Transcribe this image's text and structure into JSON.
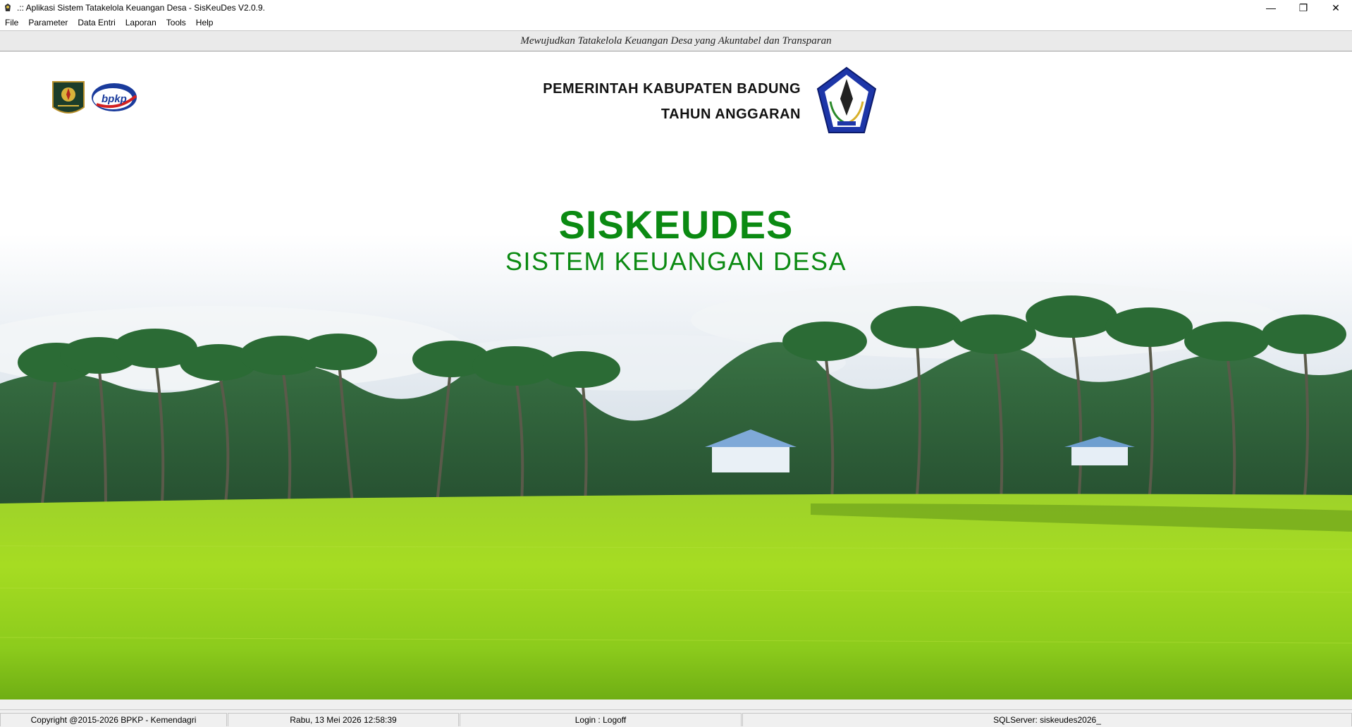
{
  "window": {
    "title": ".:: Aplikasi Sistem Tatakelola Keuangan Desa - SisKeuDes V2.0.9.",
    "minimize_glyph": "—",
    "restore_glyph": "❐",
    "close_glyph": "✕"
  },
  "menu": {
    "items": [
      {
        "label": "File"
      },
      {
        "label": "Parameter"
      },
      {
        "label": "Data Entri"
      },
      {
        "label": "Laporan"
      },
      {
        "label": "Tools"
      },
      {
        "label": "Help"
      }
    ]
  },
  "banner": {
    "text": "Mewujudkan Tatakelola Keuangan Desa yang Akuntabel dan Transparan"
  },
  "header": {
    "gov_line1": "PEMERINTAH KABUPATEN BADUNG",
    "gov_line2": "TAHUN ANGGARAN",
    "bpkp_logo_text": "bpkp"
  },
  "hero": {
    "title": "SISKEUDES",
    "subtitle": "SISTEM KEUANGAN DESA"
  },
  "status": {
    "copyright": "Copyright @2015-2026 BPKP - Kemendagri",
    "datetime": "Rabu, 13 Mei 2026  12:58:39",
    "login": "Login : Logoff",
    "sqlserver": "SQLServer: siskeudes2026_"
  },
  "colors": {
    "brand_green": "#0b8a12",
    "field_green": "#8fcf1c",
    "sky": "#dfe7ee"
  },
  "icons": [
    "app-icon",
    "kemendagri-logo",
    "bpkp-logo",
    "badung-emblem"
  ]
}
